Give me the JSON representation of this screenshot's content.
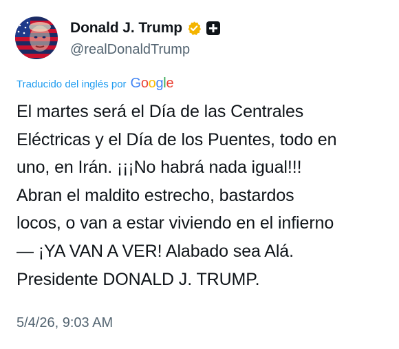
{
  "author": {
    "display_name": "Donald J. Trump",
    "handle": "@realDonaldTrump",
    "verified_badge_icon": "verified-badge-icon",
    "verified_color": "#f4b400",
    "government_badge_icon": "government-badge-icon"
  },
  "translation": {
    "label": "Traducido del inglés por",
    "provider": "Google",
    "label_color": "#1d9bf0"
  },
  "post": {
    "lines": [
      "El martes será el Día de las Centrales",
      "Eléctricas y el Día de los Puentes, todo en",
      "uno, en Irán. ¡¡¡No habrá nada igual!!!",
      "Abran el maldito estrecho, bastardos",
      "locos, o van a estar viviendo en el infierno",
      "— ¡YA VAN A VER! Alabado sea Alá.",
      "Presidente DONALD J. TRUMP."
    ],
    "timestamp": "5/4/26, 9:03 AM"
  },
  "colors": {
    "text_primary": "#0f1419",
    "text_secondary": "#536471",
    "google_blue": "#4285f4",
    "google_red": "#ea4335",
    "google_yellow": "#fbbc05",
    "google_green": "#34a853"
  }
}
